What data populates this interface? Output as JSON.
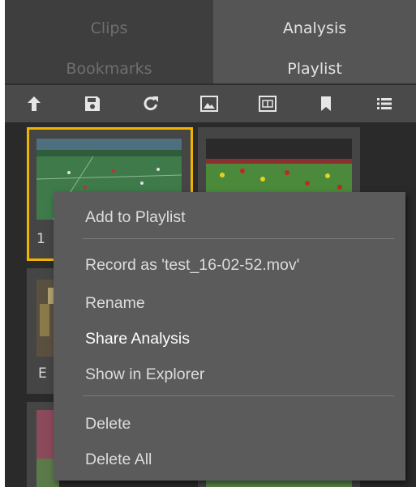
{
  "tabs": {
    "clips": "Clips",
    "analysis": "Analysis",
    "bookmarks": "Bookmarks",
    "playlist": "Playlist",
    "active": "analysis"
  },
  "toolbar": {
    "icons": [
      "upload-icon",
      "save-icon",
      "refresh-icon",
      "image-icon",
      "film-icon",
      "bookmark-icon",
      "list-icon"
    ]
  },
  "tiles": {
    "first_label_partial": "1",
    "left_label_partial": "E"
  },
  "context_menu": {
    "add_to_playlist": "Add to Playlist",
    "record_as": "Record as 'test_16-02-52.mov'",
    "rename": "Rename",
    "share_analysis": "Share Analysis",
    "show_in_explorer": "Show in Explorer",
    "delete": "Delete",
    "delete_all": "Delete All"
  },
  "colors": {
    "panel_bg": "#2d2d2d",
    "tab_active": "#555555",
    "tab_inactive": "#3e3e3e",
    "toolbar_bg": "#4a4a4a",
    "selection_outline": "#f0b400",
    "menu_bg": "#5b5b5b"
  }
}
